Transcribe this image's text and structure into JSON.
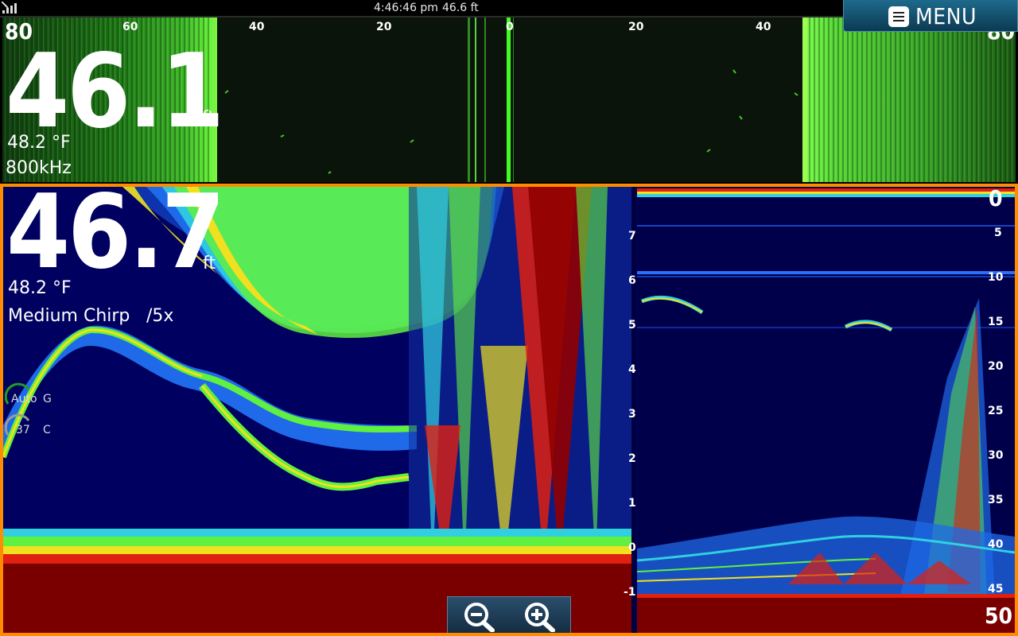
{
  "status": {
    "time": "4:46:46 pm",
    "depth": "46.6 ft"
  },
  "menu": {
    "label": "MENU"
  },
  "sidescan": {
    "range_left": "80",
    "range_right": "80",
    "scale": [
      "60",
      "40",
      "20",
      "0",
      "20",
      "40"
    ],
    "depth": "46.1",
    "unit": "ft",
    "temperature": "48.2 °F",
    "frequency": "800kHz"
  },
  "sonar": {
    "depth": "46.7",
    "unit": "ft",
    "temperature": "48.2 °F",
    "mode": "Medium Chirp",
    "zoom": "/5x",
    "gain_label": "Auto",
    "gain_letter": "G",
    "color_value": "37",
    "color_letter": "C",
    "zoom_scale": [
      "7",
      "6",
      "5",
      "4",
      "3",
      "2",
      "1",
      "0",
      "-1"
    ],
    "depth_scale": [
      "0",
      "5",
      "10",
      "15",
      "20",
      "25",
      "30",
      "35",
      "40",
      "45",
      "50"
    ]
  },
  "icons": {
    "signal": "signal-bars-icon",
    "menu": "list-icon",
    "zoom_out": "zoom-out-icon",
    "zoom_in": "zoom-in-icon"
  },
  "colors": {
    "accent_border": "#ff8c00",
    "sidescan_green": "#40ff20",
    "sonar_background": "#000060",
    "sonar_bottom": "#7a0000"
  }
}
